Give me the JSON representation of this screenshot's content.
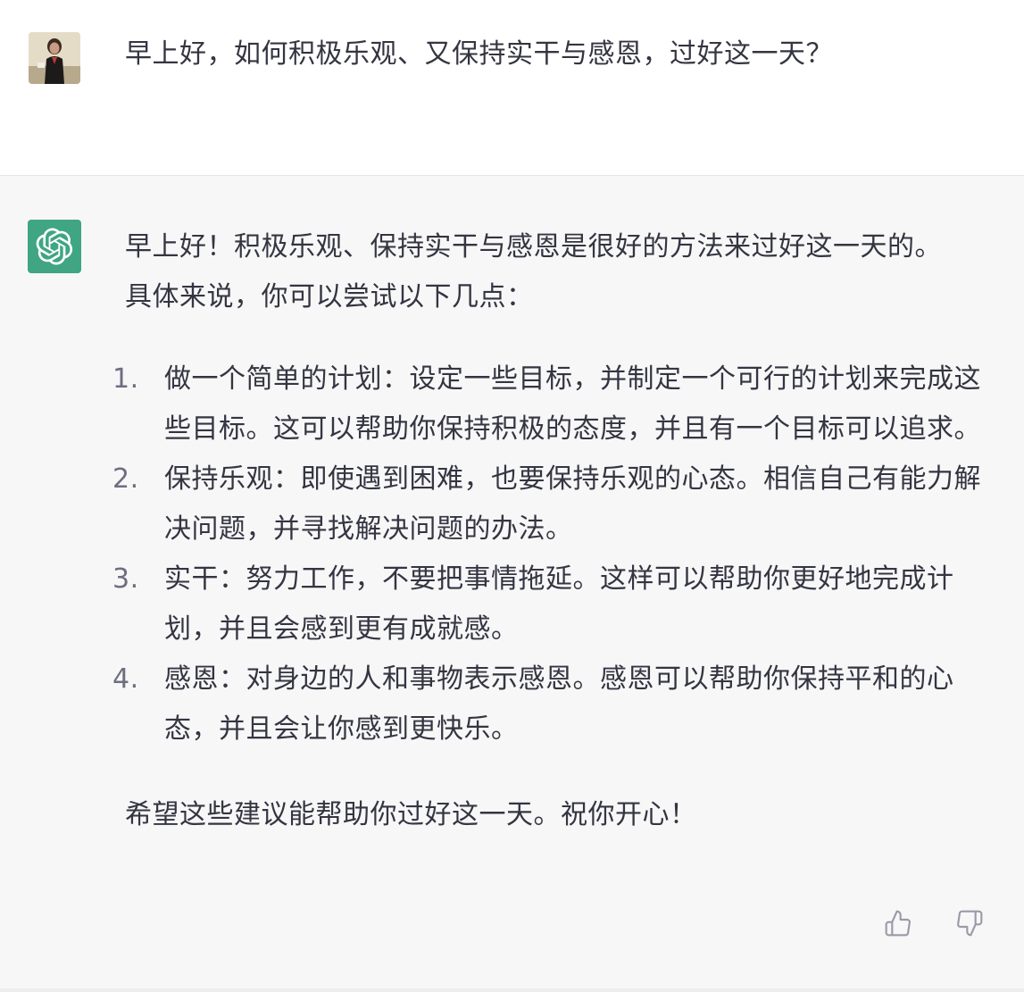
{
  "user": {
    "avatar_icon": "user-avatar-photo",
    "message": "早上好，如何积极乐观、又保持实干与感恩，过好这一天？"
  },
  "assistant": {
    "avatar_icon": "openai-logo-icon",
    "avatar_color": "#3fa583",
    "intro": "早上好！积极乐观、保持实干与感恩是很好的方法来过好这一天的。具体来说，你可以尝试以下几点：",
    "tips": [
      {
        "num": "1.",
        "text": "做一个简单的计划：设定一些目标，并制定一个可行的计划来完成这些目标。这可以帮助你保持积极的态度，并且有一个目标可以追求。"
      },
      {
        "num": "2.",
        "text": "保持乐观：即使遇到困难，也要保持乐观的心态。相信自己有能力解决问题，并寻找解决问题的办法。"
      },
      {
        "num": "3.",
        "text": "实干：努力工作，不要把事情拖延。这样可以帮助你更好地完成计划，并且会感到更有成就感。"
      },
      {
        "num": "4.",
        "text": "感恩：对身边的人和事物表示感恩。感恩可以帮助你保持平和的心态，并且会让你感到更快乐。"
      }
    ],
    "closing": "希望这些建议能帮助你过好这一天。祝你开心！"
  },
  "feedback": {
    "like_icon": "thumbs-up-icon",
    "dislike_icon": "thumbs-down-icon"
  }
}
